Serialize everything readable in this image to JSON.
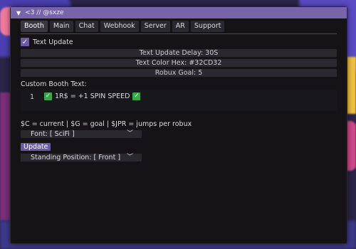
{
  "window": {
    "title": "<3 // @sxze"
  },
  "tabs": [
    {
      "label": "Booth"
    },
    {
      "label": "Main"
    },
    {
      "label": "Chat"
    },
    {
      "label": "Webhook"
    },
    {
      "label": "Server"
    },
    {
      "label": "AR"
    },
    {
      "label": "Support"
    }
  ],
  "booth": {
    "text_update": {
      "label": "Text Update",
      "checked": true
    },
    "delay_label": "Text Update Delay: 30S",
    "color_label": "Text Color Hex: #32CD32",
    "goal_label": "Robux Goal: 5",
    "custom_text_label": "Custom Booth Text:",
    "custom_text": {
      "line_number": "1",
      "content": "1R$ = +1 SPIN SPEED"
    },
    "help_text": "$C = current | $G = goal | $JPR = jumps per robux",
    "font_dropdown": "Font: [ SciFi ]",
    "update_button": "Update",
    "position_dropdown": "Standing Position: [ Front ]"
  },
  "colors": {
    "accent": "#7864a8",
    "check_green": "#3aa84a",
    "panel": "#151316"
  }
}
